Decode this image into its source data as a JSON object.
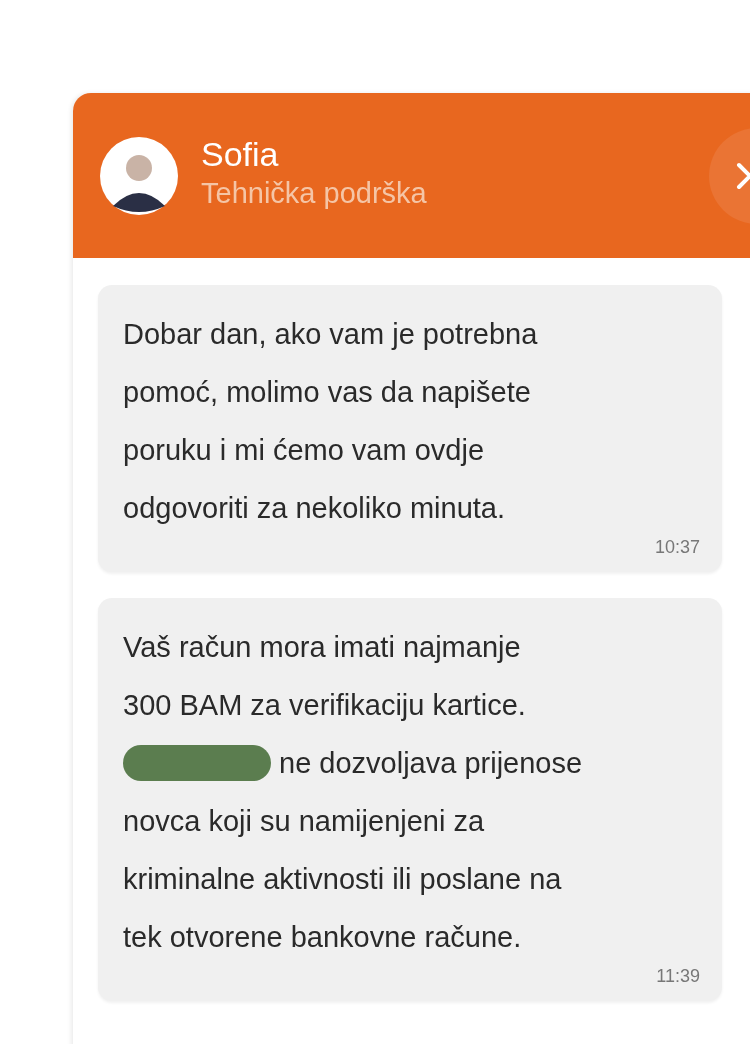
{
  "header": {
    "agent_name": "Sofia",
    "agent_role": "Tehnička podrška"
  },
  "messages": [
    {
      "lines": [
        {
          "text": "Dobar dan, ako vam je potrebna",
          "redacted": false
        },
        {
          "text": "pomoć, molimo vas da napišete",
          "redacted": false
        },
        {
          "text": "poruku i mi ćemo vam ovdje",
          "redacted": false
        },
        {
          "text": "odgovoriti za nekoliko minuta.",
          "redacted": false
        }
      ],
      "time": "10:37"
    },
    {
      "lines": [
        {
          "text": "Vaš račun mora imati najmanje",
          "redacted": false
        },
        {
          "text": "300 BAM za verifikaciju kartice.",
          "redacted": false
        },
        {
          "text": "ne dozvoljava prijenose",
          "redacted": true
        },
        {
          "text": "novca koji su namijenjeni za",
          "redacted": false
        },
        {
          "text": "kriminalne aktivnosti ili poslane na",
          "redacted": false
        },
        {
          "text": "tek otvorene bankovne račune.",
          "redacted": false
        }
      ],
      "time": "11:39"
    }
  ]
}
